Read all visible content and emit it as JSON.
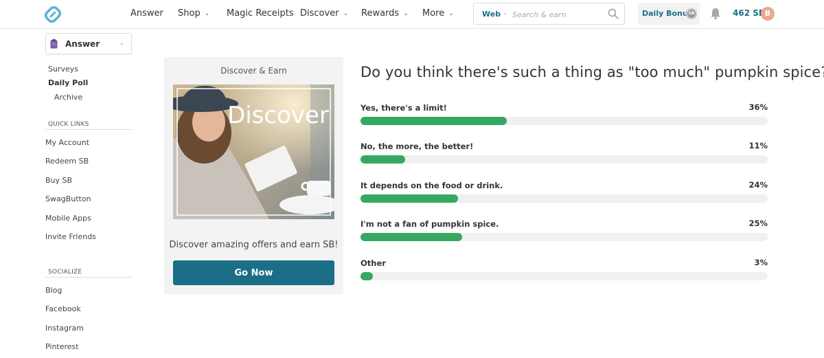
{
  "header": {
    "logo": "swagbucks-logo-icon",
    "nav": [
      {
        "label": "Answer",
        "has_dropdown": false
      },
      {
        "label": "Shop",
        "has_dropdown": true
      },
      {
        "label": "Magic Receipts",
        "has_dropdown": false
      },
      {
        "label": "Discover",
        "has_dropdown": true
      },
      {
        "label": "Rewards",
        "has_dropdown": true
      },
      {
        "label": "More",
        "has_dropdown": true
      }
    ],
    "search": {
      "scope": "Web",
      "placeholder": "Search & earn",
      "value": ""
    },
    "daily_bonus": {
      "label": "Daily Bonus",
      "coin": "SB"
    },
    "balance": "462 SB",
    "avatar_initial": "B"
  },
  "sidebar": {
    "section_select": {
      "label": "Answer",
      "icon": "clipboard-icon"
    },
    "links": [
      {
        "label": "Surveys",
        "active": false
      },
      {
        "label": "Daily Poll",
        "active": true
      },
      {
        "label": "Archive",
        "active": false
      }
    ],
    "quick_links": {
      "heading": "QUICK LINKS",
      "items": [
        "My Account",
        "Redeem SB",
        "Buy SB",
        "SwagButton",
        "Mobile Apps",
        "Invite Friends"
      ]
    },
    "socialize": {
      "heading": "SOCIALIZE",
      "items": [
        "Blog",
        "Facebook",
        "Instagram",
        "Pinterest"
      ]
    }
  },
  "promo": {
    "title": "Discover & Earn",
    "image_text": "Discover",
    "tagline": "Discover amazing offers and earn SB!",
    "button": "Go Now"
  },
  "poll": {
    "question": "Do you think there's such a thing as \"too much\" pumpkin spice?",
    "bar_color": "#36a862",
    "options": [
      {
        "label": "Yes, there's a limit!",
        "percent": 36,
        "percent_label": "36%"
      },
      {
        "label": "No, the more, the better!",
        "percent": 11,
        "percent_label": "11%"
      },
      {
        "label": "It depends on the food or drink.",
        "percent": 24,
        "percent_label": "24%"
      },
      {
        "label": "I'm not a fan of pumpkin spice.",
        "percent": 25,
        "percent_label": "25%"
      },
      {
        "label": "Other",
        "percent": 3,
        "percent_label": "3%"
      }
    ]
  }
}
